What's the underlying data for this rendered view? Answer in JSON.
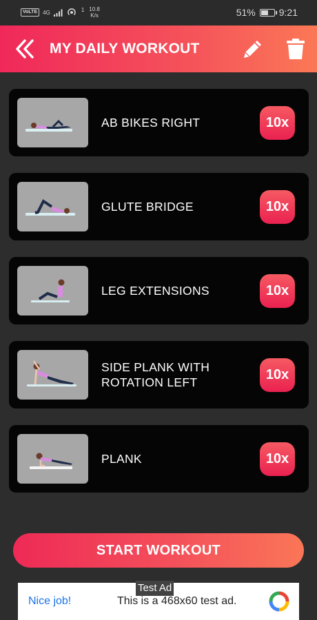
{
  "status_bar": {
    "volte": "VoLTE",
    "network": "4G",
    "speed_value": "10.8",
    "speed_unit": "K/s",
    "notification_count": "1",
    "battery_percent": "51%",
    "time": "9:21",
    "battery_level": 0.51
  },
  "header": {
    "title": "MY DAILY WORKOUT",
    "back_icon": "double-chevron-left-icon",
    "edit_icon": "pencil-icon",
    "delete_icon": "trash-icon"
  },
  "exercises": [
    {
      "name": "AB BIKES RIGHT",
      "reps": "10x"
    },
    {
      "name": "GLUTE BRIDGE",
      "reps": "10x"
    },
    {
      "name": "LEG EXTENSIONS",
      "reps": "10x"
    },
    {
      "name": "SIDE PLANK WITH ROTATION LEFT",
      "reps": "10x"
    },
    {
      "name": "PLANK",
      "reps": "10x"
    }
  ],
  "start_button": {
    "label": "START WORKOUT"
  },
  "ad": {
    "label": "Test Ad",
    "nice": "Nice job!",
    "text": "This is a 468x60 test ad."
  },
  "colors": {
    "accent_start": "#f0285a",
    "accent_end": "#fb7856",
    "card_bg": "#050505",
    "page_bg": "#2d2d2d"
  }
}
